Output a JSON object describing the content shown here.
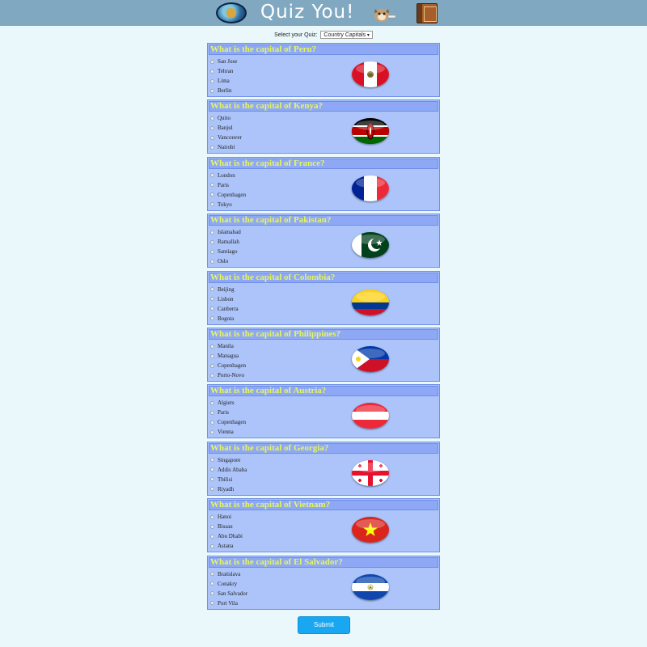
{
  "header": {
    "title": "Quiz You!"
  },
  "quiz_select": {
    "label": "Select your Quiz:",
    "value": "Country Capitals"
  },
  "questions": [
    {
      "title": "What is the capital of Peru?",
      "flag": "peru-flag-icon",
      "options": [
        "San Jose",
        "Tehran",
        "Lima",
        "Berlin"
      ]
    },
    {
      "title": "What is the capital of Kenya?",
      "flag": "kenya-flag-icon",
      "options": [
        "Quito",
        "Banjul",
        "Vancouver",
        "Nairobi"
      ]
    },
    {
      "title": "What is the capital of France?",
      "flag": "france-flag-icon",
      "options": [
        "London",
        "Paris",
        "Copenhagen",
        "Tokyo"
      ]
    },
    {
      "title": "What is the capital of Pakistan?",
      "flag": "pakistan-flag-icon",
      "options": [
        "Islamabad",
        "Ramallah",
        "Santiago",
        "Oslo"
      ]
    },
    {
      "title": "What is the capital of Colombia?",
      "flag": "colombia-flag-icon",
      "options": [
        "Beijing",
        "Lisbon",
        "Canberra",
        "Bogota"
      ]
    },
    {
      "title": "What is the capital of Philippines?",
      "flag": "philippines-flag-icon",
      "options": [
        "Manila",
        "Managua",
        "Copenhagen",
        "Porto-Novo"
      ]
    },
    {
      "title": "What is the capital of Austria?",
      "flag": "austria-flag-icon",
      "options": [
        "Algiers",
        "Paris",
        "Copenhagen",
        "Vienna"
      ]
    },
    {
      "title": "What is the capital of Georgia?",
      "flag": "georgia-flag-icon",
      "options": [
        "Singapore",
        "Addis Ababa",
        "Tbilisi",
        "Riyadh"
      ]
    },
    {
      "title": "What is the capital of Vietnam?",
      "flag": "vietnam-flag-icon",
      "options": [
        "Hanoi",
        "Bissau",
        "Abu Dhabi",
        "Astana"
      ]
    },
    {
      "title": "What is the capital of El Salvador?",
      "flag": "el-salvador-flag-icon",
      "options": [
        "Bratislava",
        "Conakry",
        "San Salvador",
        "Port Vila"
      ]
    }
  ],
  "submit": {
    "label": "Submit"
  },
  "colors": {
    "header_bg": "#80a9c1",
    "card_bg": "#acc4fa",
    "question_text": "#e6f65c",
    "submit_bg": "#1aa7f2"
  }
}
